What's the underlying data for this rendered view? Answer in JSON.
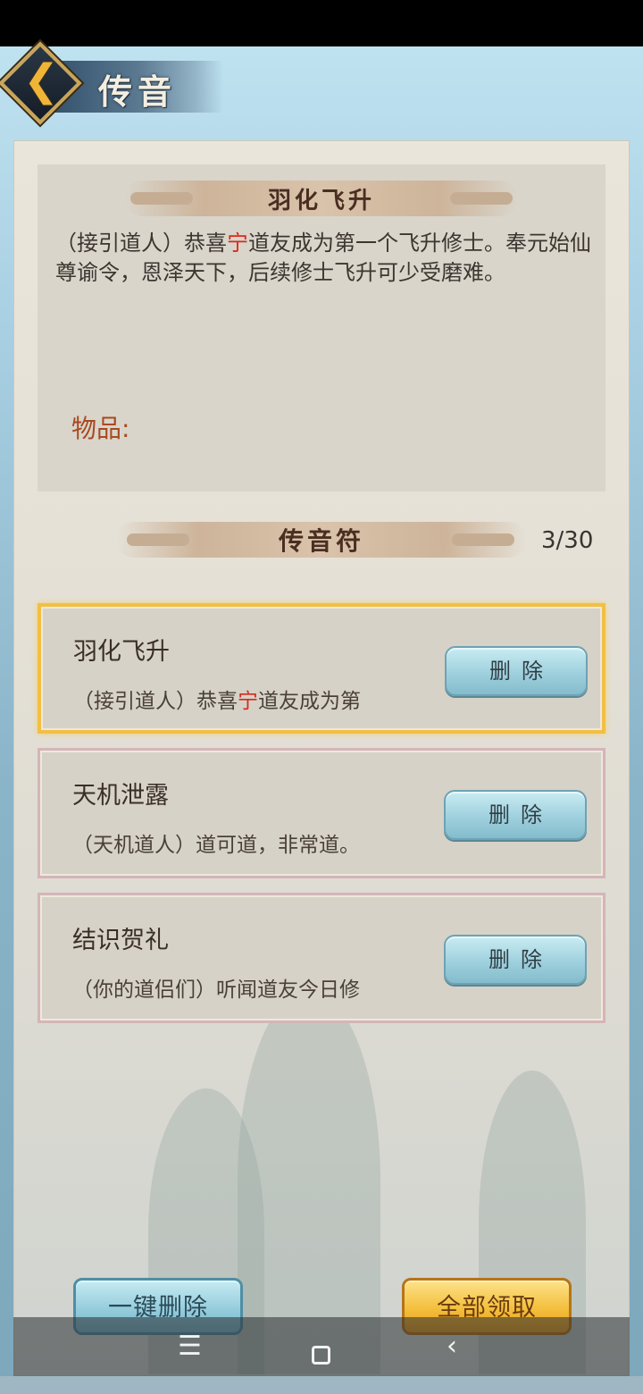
{
  "header": {
    "title": "传音",
    "back_icon": "chevron-left-icon"
  },
  "mail_detail": {
    "title": "羽化飞升",
    "body_prefix": "（接引道人）恭喜",
    "body_highlight": "宁",
    "body_suffix": "道友成为第一个飞升修士。奉元始仙尊谕令，恩泽天下，后续修士飞升可少受磨难。",
    "items_label": "物品:"
  },
  "list": {
    "section_title": "传音符",
    "count": "3/30",
    "messages": [
      {
        "title": "羽化飞升",
        "preview_prefix": "（接引道人）恭喜",
        "preview_highlight": "宁",
        "preview_suffix": "道友成为第",
        "delete_label": "删除",
        "selected": true
      },
      {
        "title": "天机泄露",
        "preview_prefix": "（天机道人）道可道，非常道。",
        "preview_highlight": "",
        "preview_suffix": "",
        "delete_label": "删除",
        "selected": false
      },
      {
        "title": "结识贺礼",
        "preview_prefix": "（你的道侣们）听闻道友今日修",
        "preview_highlight": "",
        "preview_suffix": "",
        "delete_label": "删除",
        "selected": false
      }
    ]
  },
  "actions": {
    "delete_all": "一键删除",
    "claim_all": "全部领取"
  },
  "system_nav": {
    "menu_icon": "menu-icon",
    "home_icon": "home-square-icon",
    "back_icon": "back-chevron-icon"
  },
  "colors": {
    "highlight_name": "#d72a1a",
    "selected_border": "#f2bf45",
    "items_label": "#a84a20"
  }
}
